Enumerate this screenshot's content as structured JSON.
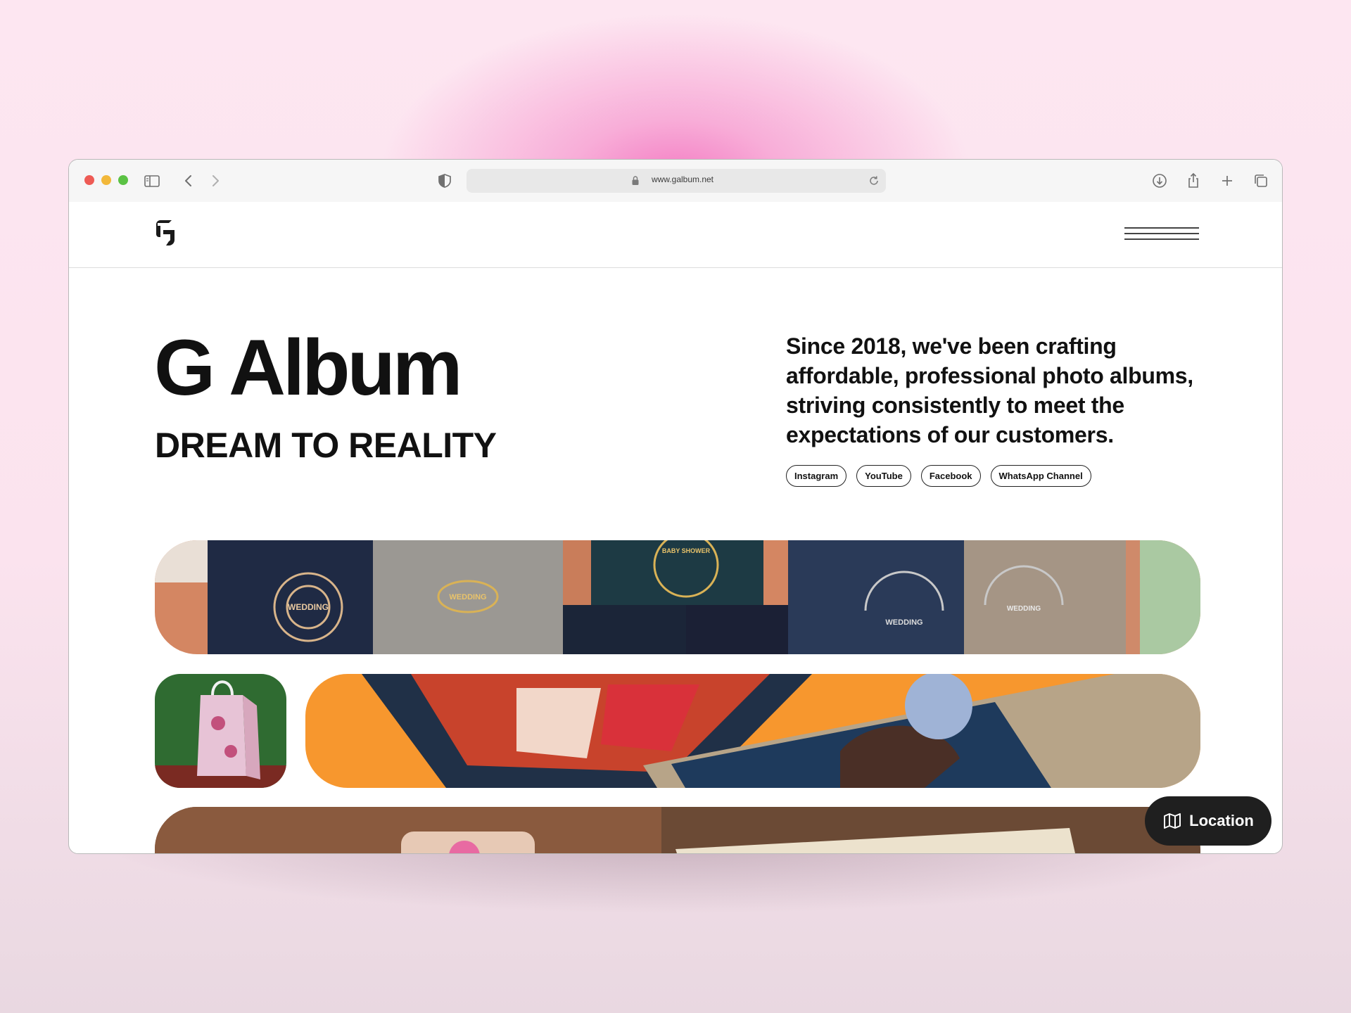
{
  "browser": {
    "url": "www.galbum.net"
  },
  "hero": {
    "title": "G Album",
    "subtitle": "DREAM TO REALITY",
    "description": "Since 2018, we've been crafting affordable, professional photo albums, striving consistently to meet the expectations of our customers."
  },
  "socials": [
    "Instagram",
    "YouTube",
    "Facebook",
    "WhatsApp Channel"
  ],
  "gallery": {
    "album_labels": [
      "WEDDING",
      "WEDDING",
      "BABY SHOWER",
      "WEDDING",
      "WEDDING"
    ]
  },
  "location_button": {
    "label": "Location",
    "icon": "map-icon"
  },
  "colors": {
    "background_pink": "#fde6f1",
    "glow_pink": "#f47fc4",
    "text": "#111111",
    "button_dark": "#1f1f1f"
  }
}
